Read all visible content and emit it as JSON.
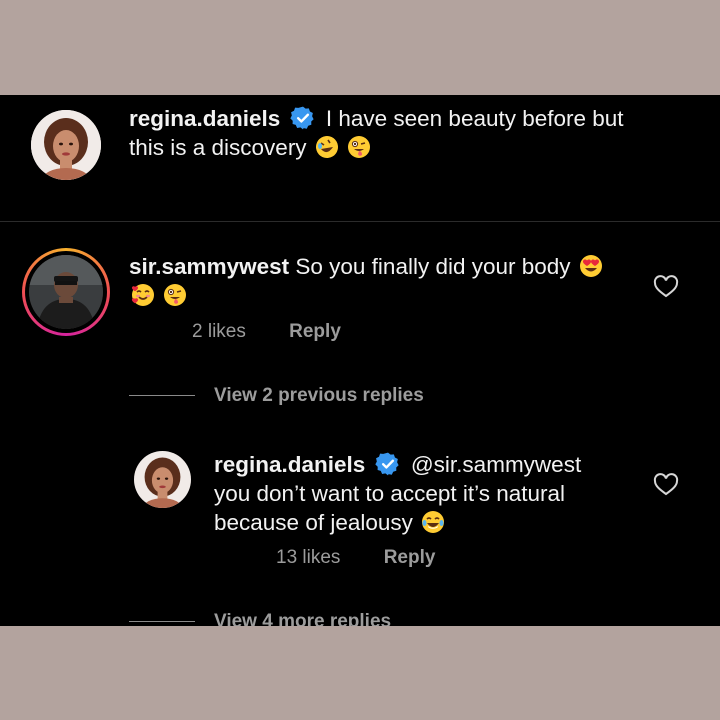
{
  "caption": {
    "username": "regina.daniels",
    "text_line1": "I have seen beauty before but",
    "text_line2": "this is a discovery",
    "emojis": [
      "rofl-emoji",
      "winking-tongue-emoji"
    ]
  },
  "comment": {
    "username": "sir.sammywest",
    "text": "So you finally did your body",
    "emojis_line1": [
      "heart-eyes-emoji"
    ],
    "emojis_line2": [
      "smiling-hearts-emoji",
      "winking-tongue-emoji"
    ],
    "likes": "2 likes",
    "reply_label": "Reply"
  },
  "view_previous": "View 2 previous replies",
  "reply": {
    "username": "regina.daniels",
    "mention": "@sir.sammywest",
    "text_line2": "you don’t want to accept it’s natural",
    "text_line3": "because of jealousy",
    "emojis": [
      "tears-of-joy-emoji"
    ],
    "likes": "13 likes",
    "reply_label": "Reply"
  },
  "view_more": "View 4 more replies",
  "colors": {
    "frame": "#b3a39e",
    "background": "#000000",
    "verified": "#3897f0",
    "muted_text": "#9c9c9c"
  }
}
